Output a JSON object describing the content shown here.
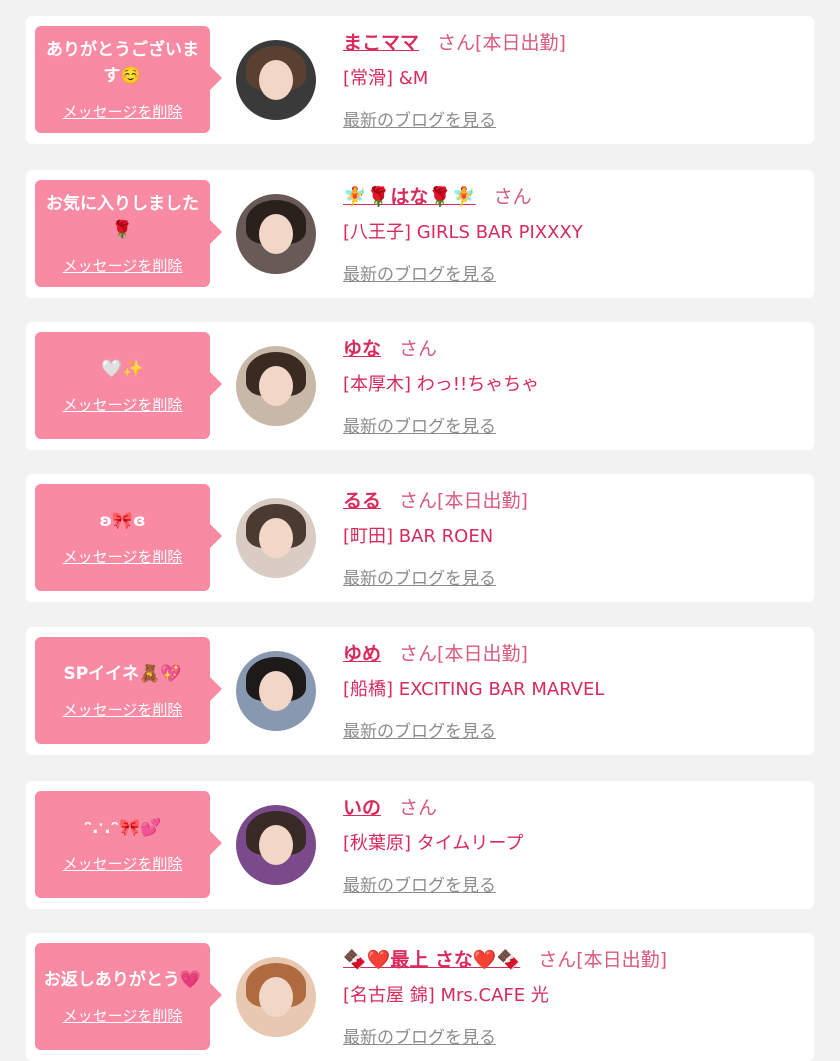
{
  "delete_label": "メッセージを削除",
  "blog_label": "最新のブログを見る",
  "san_label": "さん",
  "working_today_label": "[本日出勤]",
  "items": [
    {
      "message": "ありがとうございます☺️",
      "name": "まこママ",
      "working_today": true,
      "shop": "[常滑] &M"
    },
    {
      "message": "お気に入りしました🌹",
      "name": "🧚🌹はな🌹🧚",
      "working_today": false,
      "shop": "[八王子] GIRLS BAR PIXXXY"
    },
    {
      "message": "🤍✨",
      "name": "ゆな",
      "working_today": false,
      "shop": "[本厚木] わっ!!ちゃちゃ"
    },
    {
      "message": "ʚ🎀ɞ",
      "name": "るる",
      "working_today": true,
      "shop": "[町田] BAR ROEN"
    },
    {
      "message": "SPイイネ🧸💖",
      "name": "ゆめ",
      "working_today": true,
      "shop": "[船橋] EXCITING BAR MARVEL"
    },
    {
      "message": "ᵔ.ˑ.ᵔ🎀💕",
      "name": "いの",
      "working_today": false,
      "shop": "[秋葉原] タイムリープ"
    },
    {
      "message": "お返しありがとう💗",
      "name": "🍫❤️最上 さな❤️🍫",
      "working_today": true,
      "shop": "[名古屋 錦] Mrs.CAFE 光"
    }
  ],
  "colors": {
    "accent": "#d92a5c",
    "bubble": "#f98aa3",
    "page_bg": "#f2f2f2",
    "card_bg": "#ffffff",
    "link_gray": "#8c8c8c"
  }
}
